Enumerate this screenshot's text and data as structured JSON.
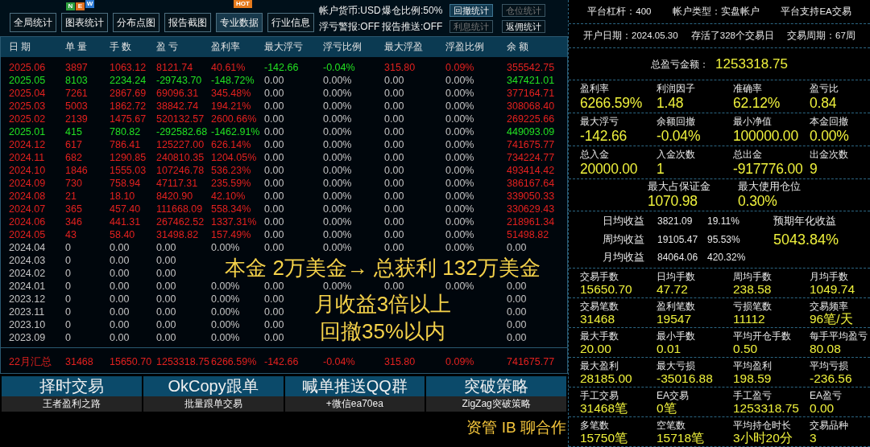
{
  "toolbar": {
    "tabs": [
      {
        "label": "全局统计",
        "selected": false
      },
      {
        "label": "图表统计",
        "selected": false,
        "badge": {
          "kind": "tiles",
          "letters": [
            {
              "text": "N",
              "color": "#2e9e3e"
            },
            {
              "text": "E",
              "color": "#e0701e"
            },
            {
              "text": "W",
              "color": "#2a78d2"
            }
          ]
        }
      },
      {
        "label": "分布点图",
        "selected": false
      },
      {
        "label": "报告截图",
        "selected": false
      },
      {
        "label": "专业数据",
        "selected": true,
        "badge": {
          "kind": "tag",
          "text": "HOT"
        }
      },
      {
        "label": "行业信息",
        "selected": false
      }
    ],
    "settings": [
      "帐户货币:USD",
      "爆仓比例:50%",
      "浮亏警报:OFF",
      "报告推送:OFF"
    ],
    "stat_buttons": [
      {
        "label": "回撤统计",
        "selected": true,
        "disabled": false
      },
      {
        "label": "仓位统计",
        "selected": false,
        "disabled": true
      },
      {
        "label": "利息统计",
        "selected": false,
        "disabled": true
      },
      {
        "label": "返佣统计",
        "selected": false,
        "disabled": false
      }
    ]
  },
  "table": {
    "columns": [
      "日 期",
      "单 量",
      "手 数",
      "盈 亏",
      "盈利率",
      "最大浮亏",
      "浮亏比例",
      "最大浮盈",
      "浮盈比例",
      "余 额"
    ],
    "rows": [
      {
        "cells": [
          {
            "text": "2025.06",
            "color": "#e3211f"
          },
          {
            "text": "3897",
            "color": "#e3211f"
          },
          {
            "text": "1063.12",
            "color": "#e3211f"
          },
          {
            "text": "8121.74",
            "color": "#e3211f"
          },
          {
            "text": "40.61%",
            "color": "#e3211f"
          },
          {
            "text": "-142.66",
            "color": "#22e022"
          },
          {
            "text": "-0.04%",
            "color": "#22e022"
          },
          {
            "text": "315.80",
            "color": "#e3211f"
          },
          {
            "text": "0.09%",
            "color": "#e3211f"
          },
          {
            "text": "355542.75",
            "color": "#e3211f"
          }
        ]
      },
      {
        "cells": [
          {
            "text": "2025.05",
            "color": "#22e022"
          },
          {
            "text": "8103",
            "color": "#22e022"
          },
          {
            "text": "2234.24",
            "color": "#22e022"
          },
          {
            "text": "-29743.70",
            "color": "#22e022"
          },
          {
            "text": "-148.72%",
            "color": "#22e022"
          },
          {
            "text": "0.00",
            "color": "#c4c4c4"
          },
          {
            "text": "0.00%",
            "color": "#c4c4c4"
          },
          {
            "text": "0.00",
            "color": "#c4c4c4"
          },
          {
            "text": "0.00%",
            "color": "#c4c4c4"
          },
          {
            "text": "347421.01",
            "color": "#22e022"
          }
        ]
      },
      {
        "cells": [
          {
            "text": "2025.04",
            "color": "#e3211f"
          },
          {
            "text": "7261",
            "color": "#e3211f"
          },
          {
            "text": "2867.69",
            "color": "#e3211f"
          },
          {
            "text": "69096.31",
            "color": "#e3211f"
          },
          {
            "text": "345.48%",
            "color": "#e3211f"
          },
          {
            "text": "0.00",
            "color": "#c4c4c4"
          },
          {
            "text": "0.00%",
            "color": "#c4c4c4"
          },
          {
            "text": "0.00",
            "color": "#c4c4c4"
          },
          {
            "text": "0.00%",
            "color": "#c4c4c4"
          },
          {
            "text": "377164.71",
            "color": "#e3211f"
          }
        ]
      },
      {
        "cells": [
          {
            "text": "2025.03",
            "color": "#e3211f"
          },
          {
            "text": "5003",
            "color": "#e3211f"
          },
          {
            "text": "1862.72",
            "color": "#e3211f"
          },
          {
            "text": "38842.74",
            "color": "#e3211f"
          },
          {
            "text": "194.21%",
            "color": "#e3211f"
          },
          {
            "text": "0.00",
            "color": "#c4c4c4"
          },
          {
            "text": "0.00%",
            "color": "#c4c4c4"
          },
          {
            "text": "0.00",
            "color": "#c4c4c4"
          },
          {
            "text": "0.00%",
            "color": "#c4c4c4"
          },
          {
            "text": "308068.40",
            "color": "#e3211f"
          }
        ]
      },
      {
        "cells": [
          {
            "text": "2025.02",
            "color": "#e3211f"
          },
          {
            "text": "2139",
            "color": "#e3211f"
          },
          {
            "text": "1475.67",
            "color": "#e3211f"
          },
          {
            "text": "520132.57",
            "color": "#e3211f"
          },
          {
            "text": "2600.66%",
            "color": "#e3211f"
          },
          {
            "text": "0.00",
            "color": "#c4c4c4"
          },
          {
            "text": "0.00%",
            "color": "#c4c4c4"
          },
          {
            "text": "0.00",
            "color": "#c4c4c4"
          },
          {
            "text": "0.00%",
            "color": "#c4c4c4"
          },
          {
            "text": "269225.66",
            "color": "#e3211f"
          }
        ]
      },
      {
        "cells": [
          {
            "text": "2025.01",
            "color": "#22e022"
          },
          {
            "text": "415",
            "color": "#22e022"
          },
          {
            "text": "780.82",
            "color": "#22e022"
          },
          {
            "text": "-292582.68",
            "color": "#22e022"
          },
          {
            "text": "-1462.91%",
            "color": "#22e022"
          },
          {
            "text": "0.00",
            "color": "#c4c4c4"
          },
          {
            "text": "0.00%",
            "color": "#c4c4c4"
          },
          {
            "text": "0.00",
            "color": "#c4c4c4"
          },
          {
            "text": "0.00%",
            "color": "#c4c4c4"
          },
          {
            "text": "449093.09",
            "color": "#22e022"
          }
        ]
      },
      {
        "cells": [
          {
            "text": "2024.12",
            "color": "#e3211f"
          },
          {
            "text": "617",
            "color": "#e3211f"
          },
          {
            "text": "786.41",
            "color": "#e3211f"
          },
          {
            "text": "125227.00",
            "color": "#e3211f"
          },
          {
            "text": "626.14%",
            "color": "#e3211f"
          },
          {
            "text": "0.00",
            "color": "#c4c4c4"
          },
          {
            "text": "0.00%",
            "color": "#c4c4c4"
          },
          {
            "text": "0.00",
            "color": "#c4c4c4"
          },
          {
            "text": "0.00%",
            "color": "#c4c4c4"
          },
          {
            "text": "741675.77",
            "color": "#e3211f"
          }
        ]
      },
      {
        "cells": [
          {
            "text": "2024.11",
            "color": "#e3211f"
          },
          {
            "text": "682",
            "color": "#e3211f"
          },
          {
            "text": "1290.85",
            "color": "#e3211f"
          },
          {
            "text": "240810.35",
            "color": "#e3211f"
          },
          {
            "text": "1204.05%",
            "color": "#e3211f"
          },
          {
            "text": "0.00",
            "color": "#c4c4c4"
          },
          {
            "text": "0.00%",
            "color": "#c4c4c4"
          },
          {
            "text": "0.00",
            "color": "#c4c4c4"
          },
          {
            "text": "0.00%",
            "color": "#c4c4c4"
          },
          {
            "text": "734224.77",
            "color": "#e3211f"
          }
        ]
      },
      {
        "cells": [
          {
            "text": "2024.10",
            "color": "#e3211f"
          },
          {
            "text": "1846",
            "color": "#e3211f"
          },
          {
            "text": "1555.03",
            "color": "#e3211f"
          },
          {
            "text": "107246.78",
            "color": "#e3211f"
          },
          {
            "text": "536.23%",
            "color": "#e3211f"
          },
          {
            "text": "0.00",
            "color": "#c4c4c4"
          },
          {
            "text": "0.00%",
            "color": "#c4c4c4"
          },
          {
            "text": "0.00",
            "color": "#c4c4c4"
          },
          {
            "text": "0.00%",
            "color": "#c4c4c4"
          },
          {
            "text": "493414.42",
            "color": "#e3211f"
          }
        ]
      },
      {
        "cells": [
          {
            "text": "2024.09",
            "color": "#e3211f"
          },
          {
            "text": "730",
            "color": "#e3211f"
          },
          {
            "text": "758.94",
            "color": "#e3211f"
          },
          {
            "text": "47117.31",
            "color": "#e3211f"
          },
          {
            "text": "235.59%",
            "color": "#e3211f"
          },
          {
            "text": "0.00",
            "color": "#c4c4c4"
          },
          {
            "text": "0.00%",
            "color": "#c4c4c4"
          },
          {
            "text": "0.00",
            "color": "#c4c4c4"
          },
          {
            "text": "0.00%",
            "color": "#c4c4c4"
          },
          {
            "text": "386167.64",
            "color": "#e3211f"
          }
        ]
      },
      {
        "cells": [
          {
            "text": "2024.08",
            "color": "#e3211f"
          },
          {
            "text": "21",
            "color": "#e3211f"
          },
          {
            "text": "18.10",
            "color": "#e3211f"
          },
          {
            "text": "8420.90",
            "color": "#e3211f"
          },
          {
            "text": "42.10%",
            "color": "#e3211f"
          },
          {
            "text": "0.00",
            "color": "#c4c4c4"
          },
          {
            "text": "0.00%",
            "color": "#c4c4c4"
          },
          {
            "text": "0.00",
            "color": "#c4c4c4"
          },
          {
            "text": "0.00%",
            "color": "#c4c4c4"
          },
          {
            "text": "339050.33",
            "color": "#e3211f"
          }
        ]
      },
      {
        "cells": [
          {
            "text": "2024.07",
            "color": "#e3211f"
          },
          {
            "text": "365",
            "color": "#e3211f"
          },
          {
            "text": "457.40",
            "color": "#e3211f"
          },
          {
            "text": "111668.09",
            "color": "#e3211f"
          },
          {
            "text": "558.34%",
            "color": "#e3211f"
          },
          {
            "text": "0.00",
            "color": "#c4c4c4"
          },
          {
            "text": "0.00%",
            "color": "#c4c4c4"
          },
          {
            "text": "0.00",
            "color": "#c4c4c4"
          },
          {
            "text": "0.00%",
            "color": "#c4c4c4"
          },
          {
            "text": "330629.43",
            "color": "#e3211f"
          }
        ]
      },
      {
        "cells": [
          {
            "text": "2024.06",
            "color": "#e3211f"
          },
          {
            "text": "346",
            "color": "#e3211f"
          },
          {
            "text": "441.31",
            "color": "#e3211f"
          },
          {
            "text": "267462.52",
            "color": "#e3211f"
          },
          {
            "text": "1337.31%",
            "color": "#e3211f"
          },
          {
            "text": "0.00",
            "color": "#c4c4c4"
          },
          {
            "text": "0.00%",
            "color": "#c4c4c4"
          },
          {
            "text": "0.00",
            "color": "#c4c4c4"
          },
          {
            "text": "0.00%",
            "color": "#c4c4c4"
          },
          {
            "text": "218961.34",
            "color": "#e3211f"
          }
        ]
      },
      {
        "cells": [
          {
            "text": "2024.05",
            "color": "#e3211f"
          },
          {
            "text": "43",
            "color": "#e3211f"
          },
          {
            "text": "58.40",
            "color": "#e3211f"
          },
          {
            "text": "31498.82",
            "color": "#e3211f"
          },
          {
            "text": "157.49%",
            "color": "#e3211f"
          },
          {
            "text": "0.00",
            "color": "#c4c4c4"
          },
          {
            "text": "0.00%",
            "color": "#c4c4c4"
          },
          {
            "text": "0.00",
            "color": "#c4c4c4"
          },
          {
            "text": "0.00%",
            "color": "#c4c4c4"
          },
          {
            "text": "51498.82",
            "color": "#e3211f"
          }
        ]
      },
      {
        "cells": [
          {
            "text": "2024.04",
            "color": "#c4c4c4"
          },
          {
            "text": "0",
            "color": "#c4c4c4"
          },
          {
            "text": "0.00",
            "color": "#c4c4c4"
          },
          {
            "text": "0.00",
            "color": "#c4c4c4"
          },
          {
            "text": "0.00%",
            "color": "#c4c4c4"
          },
          {
            "text": "0.00",
            "color": "#c4c4c4"
          },
          {
            "text": "0.00%",
            "color": "#c4c4c4"
          },
          {
            "text": "0.00",
            "color": "#c4c4c4"
          },
          {
            "text": "0.00%",
            "color": "#c4c4c4"
          },
          {
            "text": "0.00",
            "color": "#c4c4c4"
          }
        ]
      },
      {
        "cells": [
          {
            "text": "2024.03",
            "color": "#c4c4c4"
          },
          {
            "text": "0",
            "color": "#c4c4c4"
          },
          {
            "text": "0.00",
            "color": "#c4c4c4"
          },
          {
            "text": "0.00",
            "color": "#c4c4c4"
          },
          null,
          null,
          null,
          null,
          null,
          null
        ]
      },
      {
        "cells": [
          {
            "text": "2024.02",
            "color": "#c4c4c4"
          },
          {
            "text": "0",
            "color": "#c4c4c4"
          },
          {
            "text": "0.00",
            "color": "#c4c4c4"
          },
          {
            "text": "0.00",
            "color": "#c4c4c4"
          },
          null,
          null,
          null,
          null,
          null,
          null
        ]
      },
      {
        "cells": [
          {
            "text": "2024.01",
            "color": "#c4c4c4"
          },
          {
            "text": "0",
            "color": "#c4c4c4"
          },
          {
            "text": "0.00",
            "color": "#c4c4c4"
          },
          {
            "text": "0.00",
            "color": "#c4c4c4"
          },
          {
            "text": "0.00%",
            "color": "#c4c4c4"
          },
          {
            "text": "0.00",
            "color": "#c4c4c4"
          },
          {
            "text": "0.00%",
            "color": "#c4c4c4"
          },
          {
            "text": "0.00",
            "color": "#c4c4c4"
          },
          {
            "text": "0.00%",
            "color": "#c4c4c4"
          },
          {
            "text": "0.00",
            "color": "#c4c4c4"
          }
        ]
      },
      {
        "cells": [
          {
            "text": "2023.12",
            "color": "#c4c4c4"
          },
          {
            "text": "0",
            "color": "#c4c4c4"
          },
          {
            "text": "0.00",
            "color": "#c4c4c4"
          },
          {
            "text": "0.00",
            "color": "#c4c4c4"
          },
          {
            "text": "0.00%",
            "color": "#c4c4c4"
          },
          {
            "text": "0.00",
            "color": "#c4c4c4"
          },
          null,
          null,
          null,
          {
            "text": "0.00",
            "color": "#c4c4c4"
          }
        ]
      },
      {
        "cells": [
          {
            "text": "2023.11",
            "color": "#c4c4c4"
          },
          {
            "text": "0",
            "color": "#c4c4c4"
          },
          {
            "text": "0.00",
            "color": "#c4c4c4"
          },
          {
            "text": "0.00",
            "color": "#c4c4c4"
          },
          {
            "text": "0.00%",
            "color": "#c4c4c4"
          },
          {
            "text": "0.00",
            "color": "#c4c4c4"
          },
          null,
          null,
          null,
          {
            "text": "0.00",
            "color": "#c4c4c4"
          }
        ]
      },
      {
        "cells": [
          {
            "text": "2023.10",
            "color": "#c4c4c4"
          },
          {
            "text": "0",
            "color": "#c4c4c4"
          },
          {
            "text": "0.00",
            "color": "#c4c4c4"
          },
          {
            "text": "0.00",
            "color": "#c4c4c4"
          },
          {
            "text": "0.00%",
            "color": "#c4c4c4"
          },
          {
            "text": "0.00",
            "color": "#c4c4c4"
          },
          null,
          null,
          null,
          {
            "text": "0.00",
            "color": "#c4c4c4"
          }
        ]
      },
      {
        "cells": [
          {
            "text": "2023.09",
            "color": "#c4c4c4"
          },
          {
            "text": "0",
            "color": "#c4c4c4"
          },
          {
            "text": "0.00",
            "color": "#c4c4c4"
          },
          {
            "text": "0.00",
            "color": "#c4c4c4"
          },
          {
            "text": "0.00%",
            "color": "#c4c4c4"
          },
          {
            "text": "0.00",
            "color": "#c4c4c4"
          },
          null,
          null,
          null,
          {
            "text": "0.00",
            "color": "#c4c4c4"
          }
        ]
      }
    ],
    "total": {
      "cells": [
        {
          "text": "22月汇总",
          "color": "#e3211f"
        },
        {
          "text": "31468",
          "color": "#e3211f"
        },
        {
          "text": "15650.70",
          "color": "#e3211f"
        },
        {
          "text": "1253318.75",
          "color": "#e3211f"
        },
        {
          "text": "6266.59%",
          "color": "#e3211f"
        },
        {
          "text": "-142.66",
          "color": "#e3211f"
        },
        {
          "text": "-0.04%",
          "color": "#e3211f"
        },
        {
          "text": "315.80",
          "color": "#e3211f"
        },
        {
          "text": "0.09%",
          "color": "#e3211f"
        },
        {
          "text": "741675.77",
          "color": "#e3211f"
        }
      ]
    }
  },
  "promo_overlay": [
    "本金 2万美金→ 总获利 132万美金",
    "月收益3倍以上",
    "回撤35%以内"
  ],
  "promo_buttons": [
    {
      "title": "择时交易",
      "subtitle": "王者盈利之路"
    },
    {
      "title": "OkCopy跟单",
      "subtitle": "批量跟单交易"
    },
    {
      "title": "喊单推送QQ群",
      "subtitle": "+微信ea70ea"
    },
    {
      "title": "突破策略",
      "subtitle": "ZigZag突破策略"
    }
  ],
  "footer": "资管 IB 聊合作",
  "sections": [
    {
      "kind": "info",
      "items": [
        "平台杠杆：400",
        "帐户类型：实盘帐户",
        "平台支持EA交易"
      ]
    },
    {
      "kind": "info",
      "items": [
        "开户日期：2024.05.30",
        "存活了328个交易日",
        "交易周期：67周"
      ]
    },
    {
      "kind": "total",
      "label": "总盈亏金额：",
      "value": "1253318.75"
    },
    {
      "kind": "grid",
      "items": [
        {
          "label": "盈利率",
          "value": "6266.59%"
        },
        {
          "label": "利润因子",
          "value": "1.48"
        },
        {
          "label": "准确率",
          "value": "62.12%"
        },
        {
          "label": "盈亏比",
          "value": "0.84"
        }
      ]
    },
    {
      "kind": "grid",
      "items": [
        {
          "label": "最大浮亏",
          "value": "-142.66"
        },
        {
          "label": "余额回撤",
          "value": "-0.04%"
        },
        {
          "label": "最小净值",
          "value": "100000.00"
        },
        {
          "label": "本金回撤",
          "value": "0.00%"
        }
      ]
    },
    {
      "kind": "grid",
      "items": [
        {
          "label": "总入金",
          "value": "20000.00"
        },
        {
          "label": "入金次数",
          "value": "1"
        },
        {
          "label": "总出金",
          "value": "-917776.00"
        },
        {
          "label": "出金次数",
          "value": "9"
        }
      ]
    },
    {
      "kind": "pair",
      "items": [
        {
          "label": "最大占保证金",
          "value": "1070.98"
        },
        {
          "label": "最大使用仓位",
          "value": "0.30%"
        }
      ]
    },
    {
      "kind": "averages",
      "rows": [
        {
          "label": "日均收益",
          "amount": "3821.09",
          "percent": "19.11%"
        },
        {
          "label": "周均收益",
          "amount": "19105.47",
          "percent": "95.53%"
        },
        {
          "label": "月均收益",
          "amount": "84064.06",
          "percent": "420.32%"
        }
      ],
      "forecast": {
        "label": "预期年化收益",
        "value": "5043.84%"
      }
    },
    {
      "kind": "grid",
      "items": [
        {
          "label": "交易手数",
          "value": "15650.70"
        },
        {
          "label": "日均手数",
          "value": "47.72"
        },
        {
          "label": "周均手数",
          "value": "238.58"
        },
        {
          "label": "月均手数",
          "value": "1049.74"
        }
      ]
    },
    {
      "kind": "grid",
      "items": [
        {
          "label": "交易笔数",
          "value": "31468"
        },
        {
          "label": "盈利笔数",
          "value": "19547"
        },
        {
          "label": "亏损笔数",
          "value": "11112"
        },
        {
          "label": "交易频率",
          "value": "96笔/天"
        }
      ]
    },
    {
      "kind": "grid",
      "items": [
        {
          "label": "最大手数",
          "value": "20.00"
        },
        {
          "label": "最小手数",
          "value": "0.01"
        },
        {
          "label": "平均开仓手数",
          "value": "0.50"
        },
        {
          "label": "每手平均盈亏",
          "value": "80.08"
        }
      ]
    },
    {
      "kind": "grid",
      "items": [
        {
          "label": "最大盈利",
          "value": "28185.00"
        },
        {
          "label": "最大亏损",
          "value": "-35016.88"
        },
        {
          "label": "平均盈利",
          "value": "198.59"
        },
        {
          "label": "平均亏损",
          "value": "-236.56"
        }
      ]
    },
    {
      "kind": "grid",
      "items": [
        {
          "label": "手工交易",
          "value": "31468笔"
        },
        {
          "label": "EA交易",
          "value": "0笔"
        },
        {
          "label": "手工盈亏",
          "value": "1253318.75"
        },
        {
          "label": "EA盈亏",
          "value": "0.00"
        }
      ]
    },
    {
      "kind": "grid",
      "items": [
        {
          "label": "多笔数",
          "value": "15750笔"
        },
        {
          "label": "空笔数",
          "value": "15718笔"
        },
        {
          "label": "平均持仓时长",
          "value": "3小时20分"
        },
        {
          "label": "交易品种",
          "value": "3"
        }
      ]
    }
  ]
}
